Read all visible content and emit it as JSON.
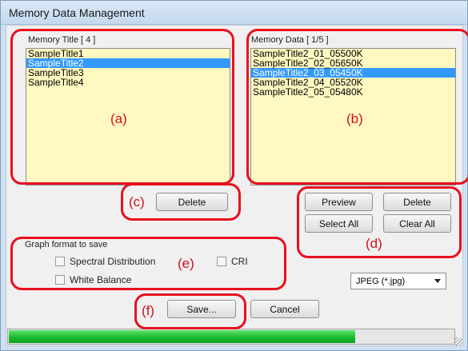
{
  "window": {
    "title": "Memory Data Management"
  },
  "memory_title": {
    "label": "Memory Title [ 4 ]",
    "items": [
      "SampleTitle1",
      "SampleTitle2",
      "SampleTitle3",
      "SampleTitle4"
    ],
    "selected_index": 1
  },
  "memory_data": {
    "label": "Memory Data [ 1/5 ]",
    "items": [
      "SampleTitle2_01_05500K",
      "SampleTitle2_02_05650K",
      "SampleTitle2_03_05450K",
      "SampleTitle2_04_05520K",
      "SampleTitle2_05_05480K"
    ],
    "selected_index": 2
  },
  "buttons": {
    "delete_title": "Delete",
    "preview": "Preview",
    "delete_data": "Delete",
    "select_all": "Select All",
    "clear_all": "Clear All",
    "save": "Save...",
    "cancel": "Cancel"
  },
  "graph_format": {
    "label": "Graph format to save",
    "spectral": "Spectral Distribution",
    "cri": "CRI",
    "white_balance": "White Balance",
    "format_value": "JPEG (*.jpg)"
  },
  "progress": {
    "fraction": 0.78
  },
  "annotations": {
    "a": "(a)",
    "b": "(b)",
    "c": "(c)",
    "d": "(d)",
    "e": "(e)",
    "f": "(f)"
  },
  "colors": {
    "list_background": "#fff8c0",
    "selection": "#3399ff",
    "callout": "#e8101d",
    "progress": "#16b82a"
  }
}
